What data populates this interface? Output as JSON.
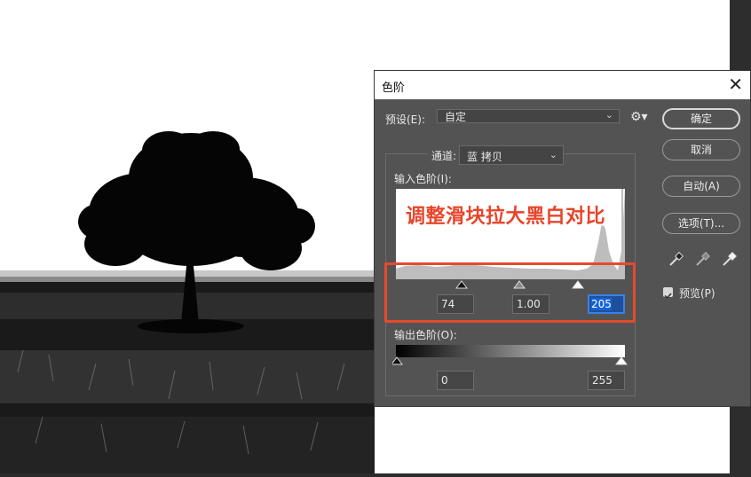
{
  "dialog": {
    "title": "色阶",
    "preset_label": "预设(E):",
    "preset_value": "自定",
    "channel_label": "通道:",
    "channel_value": "蓝 拷贝",
    "input_levels_label": "输入色阶(I):",
    "input_black": "74",
    "input_gamma": "1.00",
    "input_white": "205",
    "output_levels_label": "输出色阶(O):",
    "output_black": "0",
    "output_white": "255",
    "buttons": {
      "ok": "确定",
      "cancel": "取消",
      "auto": "自动(A)",
      "options": "选项(T)..."
    },
    "preview_label": "预览(P)",
    "preview_checked": true
  },
  "annotation": {
    "text": "调整滑块拉大黑白对比",
    "color": "#e8442a"
  },
  "colors": {
    "dialog_bg": "#535353",
    "highlight": "#e64a2e",
    "focus": "#3a82e6"
  }
}
